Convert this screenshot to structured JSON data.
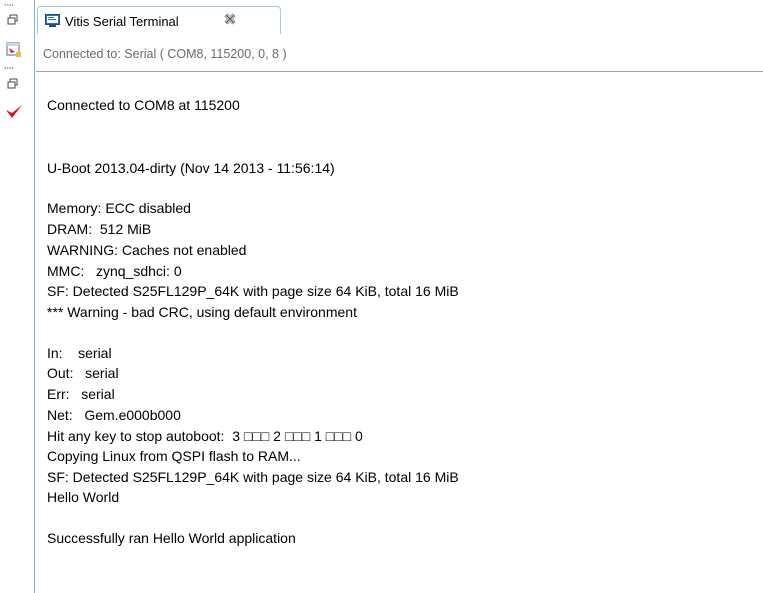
{
  "tab": {
    "title": "Vitis Serial Terminal",
    "close_icon": "close-icon",
    "terminal_icon": "terminal-icon"
  },
  "connection_status": "Connected to: Serial ( COM8, 115200, 0, 8 )",
  "side_icons": [
    "restore-icon",
    "import-icon",
    "restore-icon",
    "checkmark-icon"
  ],
  "console_lines": [
    "Connected to COM8 at 115200",
    "U-Boot 2013.04-dirty (Nov 14 2013 - 11:56:14)",
    "Memory: ECC disabled",
    "DRAM:  512 MiB",
    "WARNING: Caches not enabled",
    "MMC:   zynq_sdhci: 0",
    "SF: Detected S25FL129P_64K with page size 64 KiB, total 16 MiB",
    "*** Warning - bad CRC, using default environment",
    "In:    serial",
    "Out:   serial",
    "Err:   serial",
    "Net:   Gem.e000b000",
    "Hit any key to stop autoboot:  3 □□□ 2 □□□ 1 □□□ 0",
    "Copying Linux from QSPI flash to RAM...",
    "SF: Detected S25FL129P_64K with page size 64 KiB, total 16 MiB",
    "Hello World",
    "Successfully ran Hello World application"
  ],
  "colors": {
    "tab_border": "#a9c6e3",
    "subtitle_text": "#6b6b6b",
    "accent_red": "#cc1a1a"
  }
}
